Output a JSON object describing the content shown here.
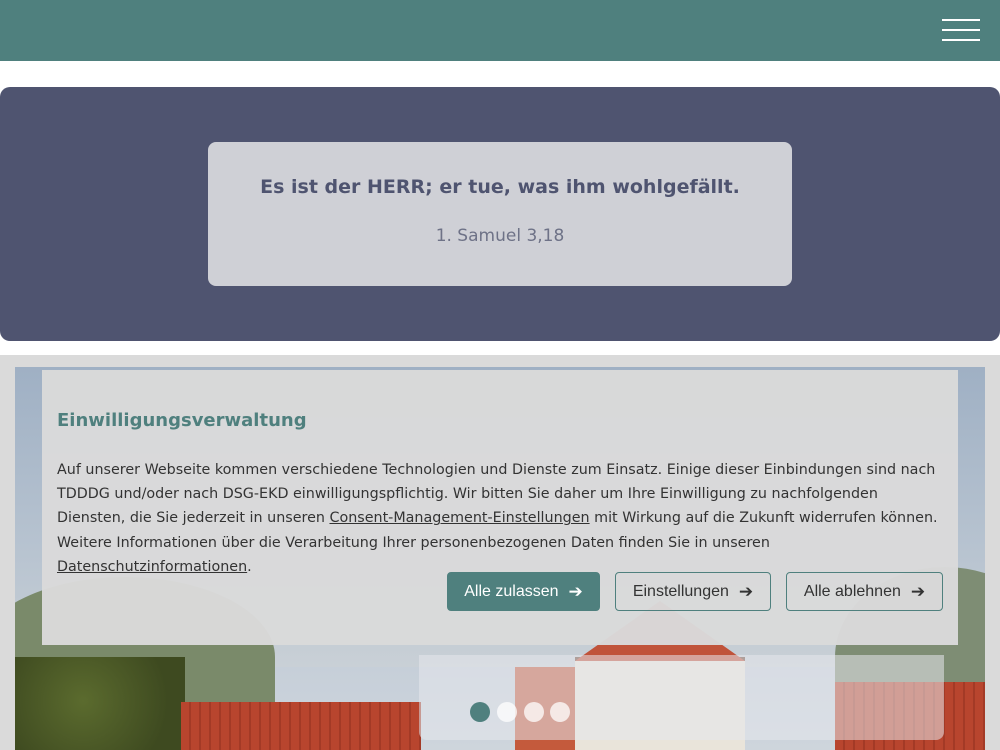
{
  "header": {
    "background": "#4f807e",
    "menu_icon": "hamburger-menu-icon"
  },
  "verse": {
    "text": "Es ist der HERR; er tue, was ihm wohlgefällt.",
    "reference": "1. Samuel 3,18",
    "background": "#4f5470"
  },
  "carousel": {
    "slide_count": 4,
    "active_index": 0
  },
  "consent": {
    "title": "Einwilligungsverwaltung",
    "text_part1": "Auf unserer Webseite kommen verschiedene Technologien und Dienste zum Einsatz. Einige dieser Einbindungen sind nach TDDDG und/oder nach DSG-EKD einwilligungspflichtig. Wir bitten Sie daher um Ihre Einwilligung zu nachfolgenden Diensten, die Sie jederzeit in unseren ",
    "link_consent": "Consent-Management-Einstellungen",
    "text_part2": " mit Wirkung auf die Zukunft widerrufen können. Weitere Informationen über die Verarbeitung Ihrer personenbezogenen Daten finden Sie in unseren ",
    "link_privacy": "Datenschutzinformationen",
    "text_part3": ".",
    "accept_label": "Alle zulassen",
    "settings_label": "Einstellungen",
    "reject_label": "Alle ablehnen",
    "arrow_icon": "arrow-right-icon",
    "accent_color": "#4f807e"
  }
}
